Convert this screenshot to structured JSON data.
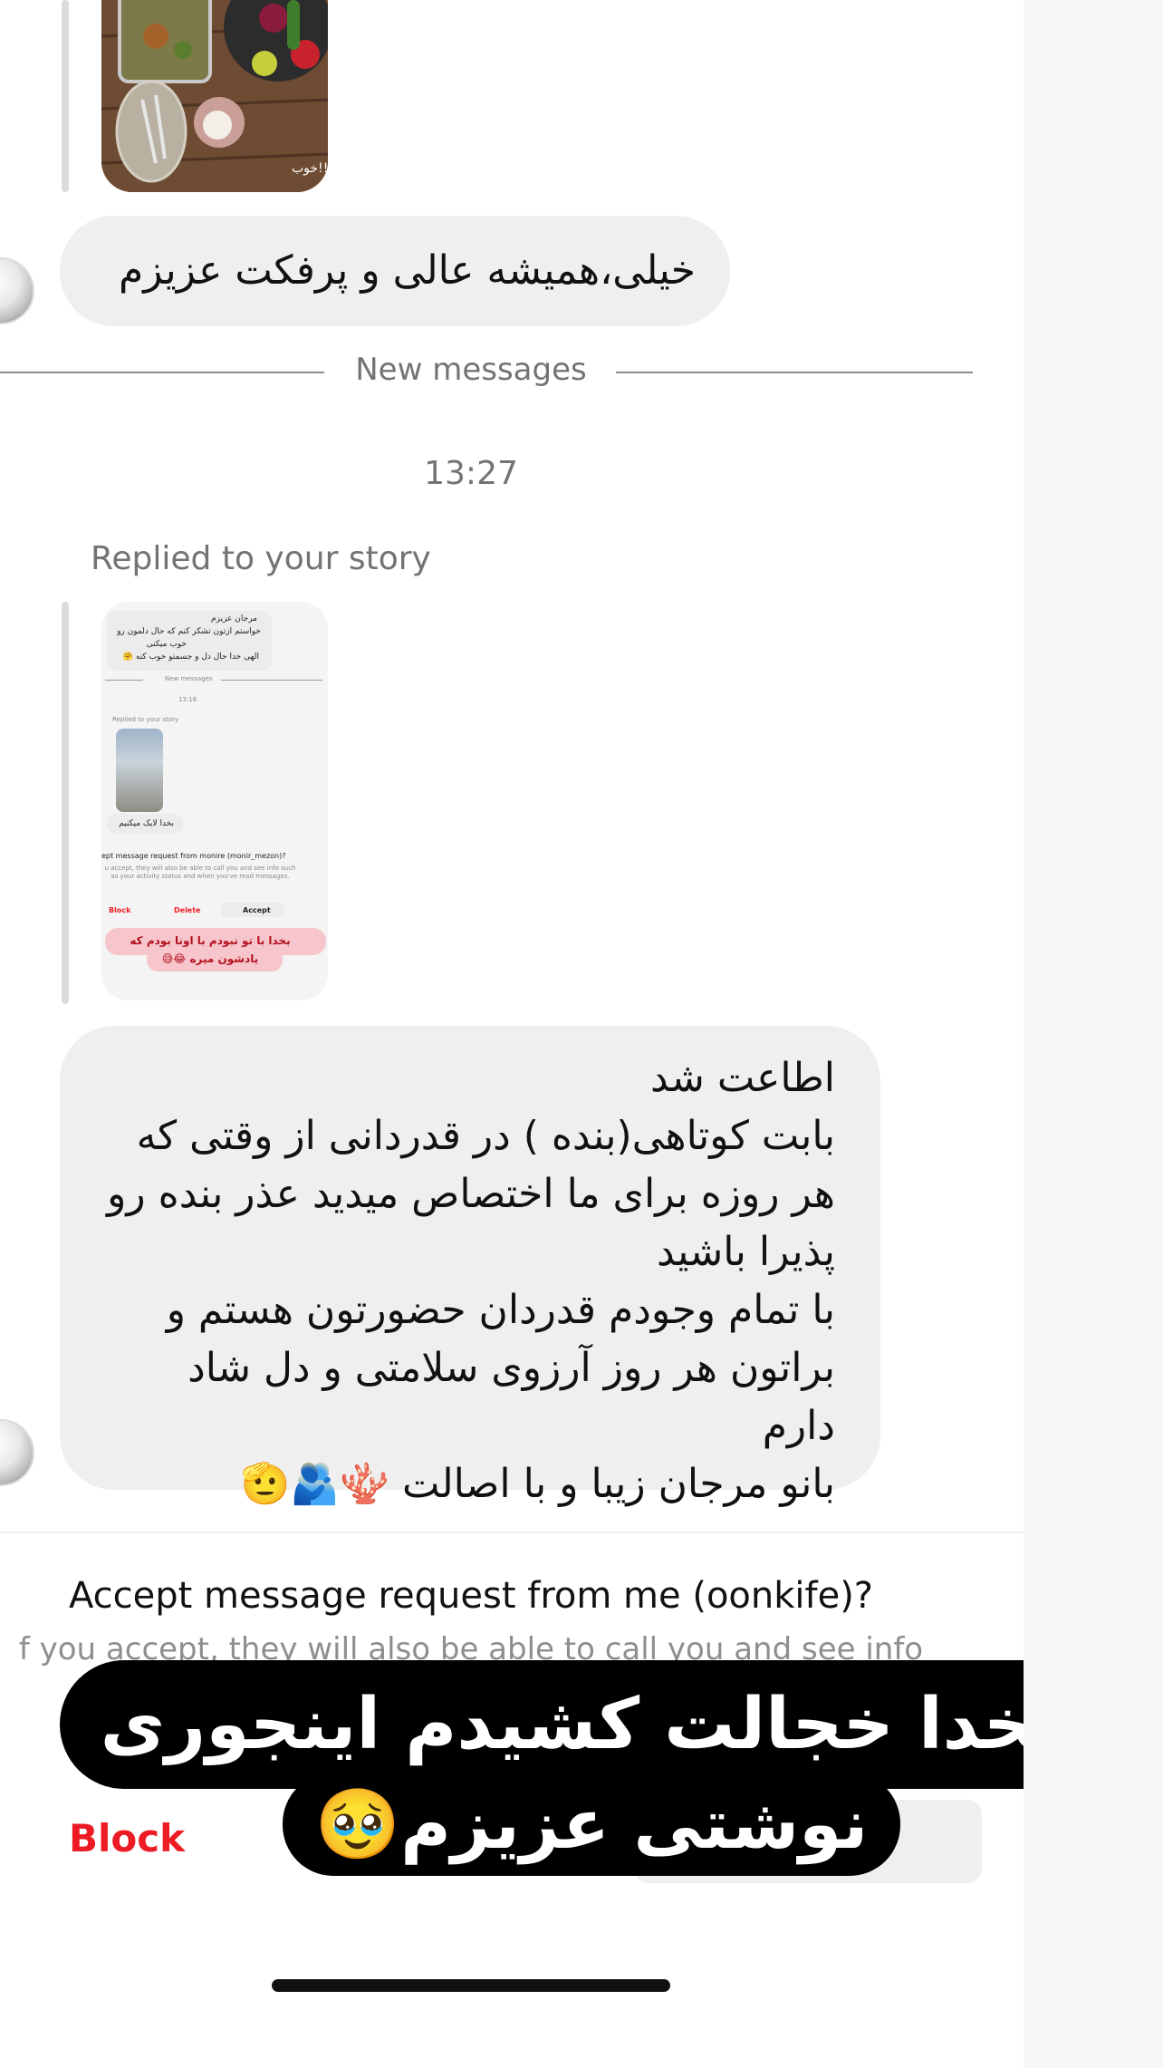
{
  "messages": {
    "first_message": "خیلی،همیشه عالی و پرفکت عزیزم",
    "new_messages_label": "New messages",
    "timestamp": "13:27",
    "replied_label": "Replied to your story",
    "story_preview": {
      "bubble_line1": "مرجان عزیزم",
      "bubble_line2": "خواستم ازتون تشکر کنم که حال دلمون رو",
      "bubble_line3": "خوب میکنی",
      "bubble_line4": "الهی خدا حال دل و جسمتو خوب کنه 🤗",
      "new_messages": "New messages",
      "time": "13:16",
      "replied": "Replied to your story",
      "reply_text": "بخدا لایک میکنیم",
      "accept_q": "ept message request from monire (monir_mezon)?",
      "accept_info": "u accept, they will also be able to call you and see info such as your activity status and when you've read messages.",
      "block": "Block",
      "delete": "Delete",
      "accept": "Accept",
      "sticker": "بخدا با تو نبودم با اونا بودم که یادشون میره 😂😅"
    },
    "second_message": "اطاعت شد\nبابت کوتاهی(بنده ) در قدردانی از وقتی که هر روزه برای ما اختصاص میدید عذر بنده رو پذیرا باشید\nبا تمام وجودم قدردان حضورتون هستم و براتون هر روز آرزوی سلامتی و دل شاد دارم\nبانو مرجان زیبا و با اصالت 🪸🫂🫡"
  },
  "request": {
    "title": "Accept message request from me (oonkife)?",
    "subtitle": "f you accept, they will also be able to call you and see info",
    "block_label": "Block"
  },
  "overlay": {
    "line1": "بخدا خجالت کشیدم اینجوری",
    "line2": "نوشتی عزیزم🥹"
  },
  "colors": {
    "block_red": "#ed1c24",
    "bubble_gray": "#efefef",
    "meta_gray": "#737373"
  }
}
